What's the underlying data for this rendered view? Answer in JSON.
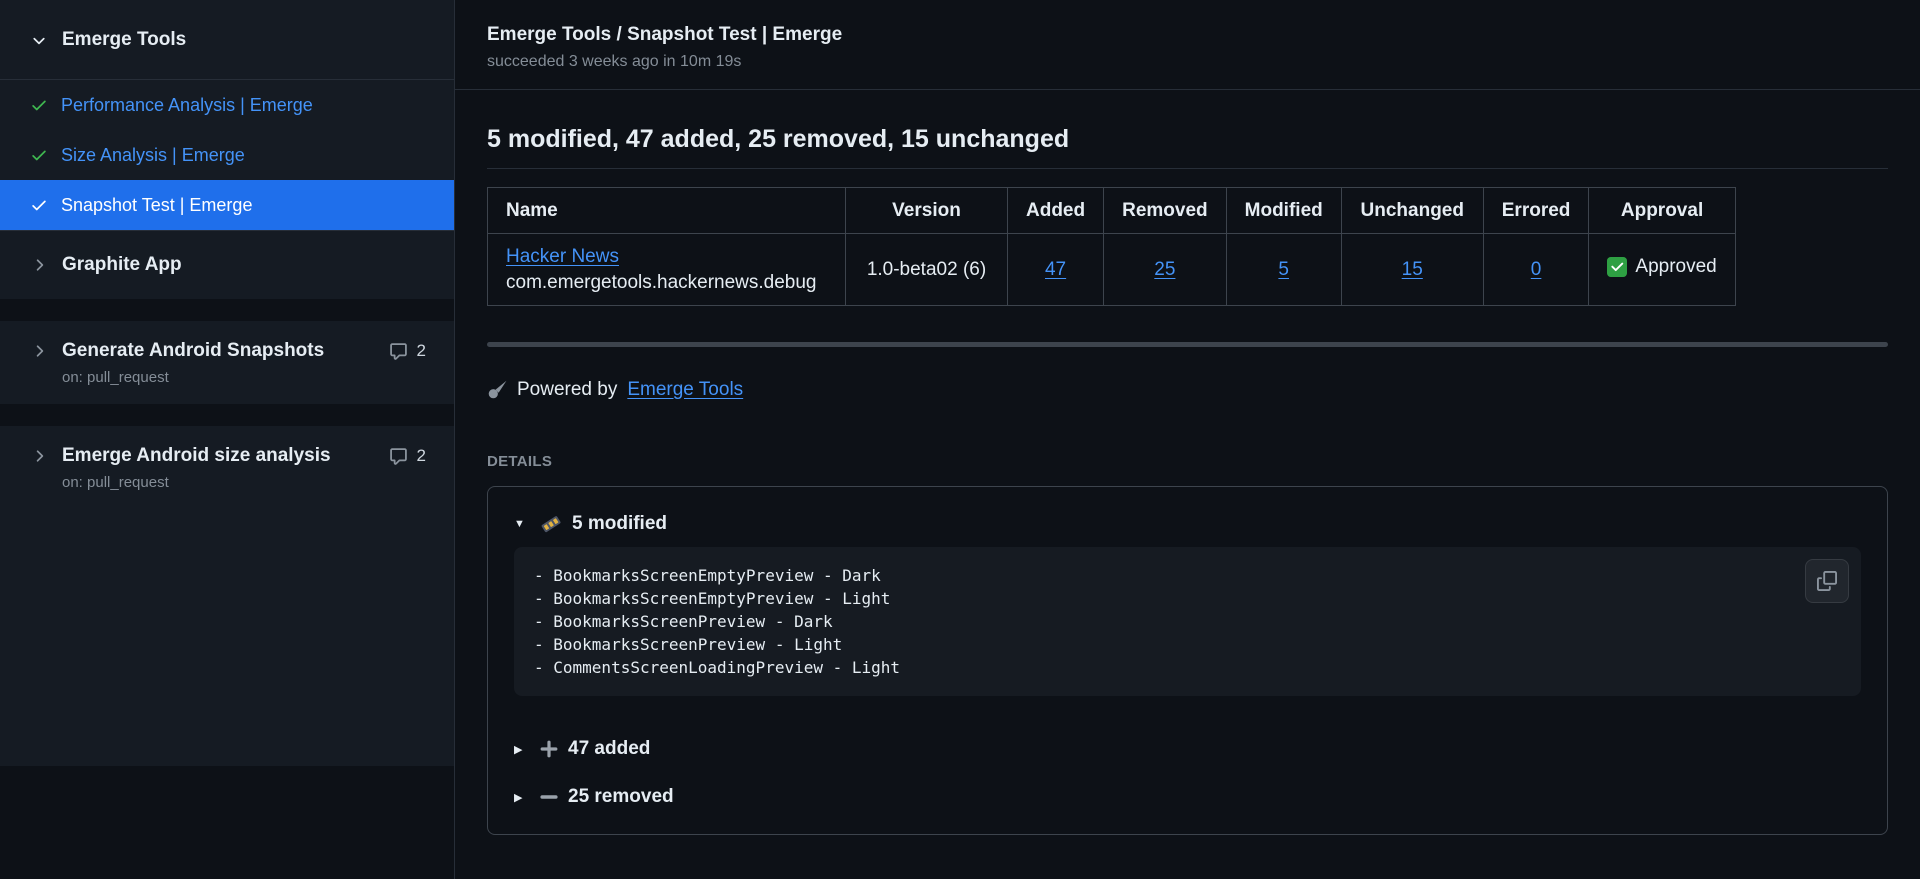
{
  "colors": {
    "accent": "#1f6feb",
    "link": "#4493f8",
    "success": "#3fb950",
    "approved_badge": "#2ea043"
  },
  "icons": {
    "caret_down": "▼",
    "caret_right": "▶"
  },
  "sidebar": {
    "header": {
      "title": "Emerge Tools"
    },
    "checks": [
      {
        "label": "Performance Analysis | Emerge"
      },
      {
        "label": "Size Analysis | Emerge"
      },
      {
        "label": "Snapshot Test | Emerge"
      }
    ],
    "apps": [
      {
        "label": "Graphite App"
      }
    ],
    "workflows": [
      {
        "title": "Generate Android Snapshots",
        "trigger": "on: pull_request",
        "annotation_count": "2"
      },
      {
        "title": "Emerge Android size analysis",
        "trigger": "on: pull_request",
        "annotation_count": "2"
      }
    ]
  },
  "run": {
    "title": "Emerge Tools / Snapshot Test | Emerge",
    "status_line": "succeeded 3 weeks ago in 10m 19s"
  },
  "output": {
    "heading": "5 modified, 47 added, 25 removed, 15 unchanged",
    "table": {
      "headers": [
        "Name",
        "Version",
        "Added",
        "Removed",
        "Modified",
        "Unchanged",
        "Errored",
        "Approval"
      ],
      "row": {
        "name": "Hacker News",
        "bundle_id": "com.emergetools.hackernews.debug",
        "version": "1.0-beta02 (6)",
        "added": "47",
        "removed": "25",
        "modified": "5",
        "unchanged": "15",
        "errored": "0",
        "approval": "Approved"
      }
    },
    "powered_by": {
      "prefix": "Powered by",
      "link_label": "Emerge Tools"
    },
    "details_label": "DETAILS",
    "sections": {
      "modified": {
        "title": "5 modified",
        "lines": [
          "- BookmarksScreenEmptyPreview - Dark",
          "- BookmarksScreenEmptyPreview - Light",
          "- BookmarksScreenPreview - Dark",
          "- BookmarksScreenPreview - Light",
          "- CommentsScreenLoadingPreview - Light"
        ]
      },
      "added": {
        "title": "47 added"
      },
      "removed": {
        "title": "25 removed"
      }
    }
  }
}
